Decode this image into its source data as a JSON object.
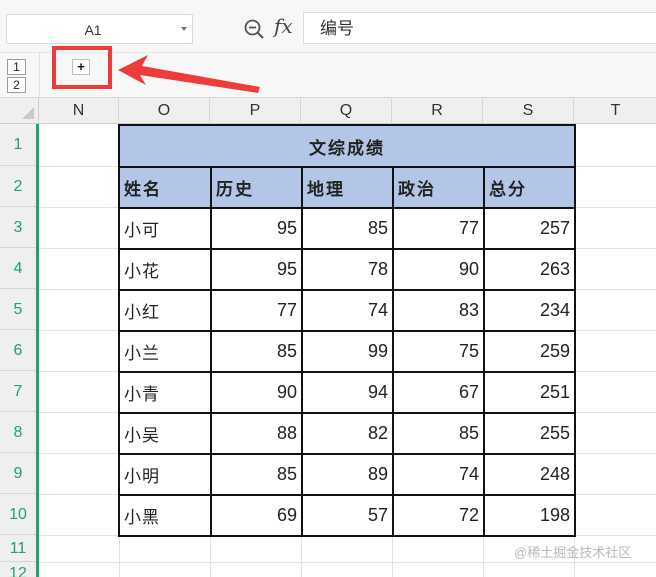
{
  "formula_bar": {
    "cell_ref": "A1",
    "fx_label": "fx",
    "content": "编号"
  },
  "outline": {
    "levels": [
      "1",
      "2"
    ],
    "expand_symbol": "+"
  },
  "columns": [
    "N",
    "O",
    "P",
    "Q",
    "R",
    "S",
    "T"
  ],
  "rows": [
    "1",
    "2",
    "3",
    "4",
    "5",
    "6",
    "7",
    "8",
    "9",
    "10",
    "11",
    "12"
  ],
  "table": {
    "title": "文综成绩",
    "headers": [
      "姓名",
      "历史",
      "地理",
      "政治",
      "总分"
    ],
    "records": [
      {
        "name": "小可",
        "history": "95",
        "geography": "85",
        "politics": "77",
        "total": "257"
      },
      {
        "name": "小花",
        "history": "95",
        "geography": "78",
        "politics": "90",
        "total": "263"
      },
      {
        "name": "小红",
        "history": "77",
        "geography": "74",
        "politics": "83",
        "total": "234"
      },
      {
        "name": "小兰",
        "history": "85",
        "geography": "99",
        "politics": "75",
        "total": "259"
      },
      {
        "name": "小青",
        "history": "90",
        "geography": "94",
        "politics": "67",
        "total": "251"
      },
      {
        "name": "小吴",
        "history": "88",
        "geography": "82",
        "politics": "85",
        "total": "255"
      },
      {
        "name": "小明",
        "history": "85",
        "geography": "89",
        "politics": "74",
        "total": "248"
      },
      {
        "name": "小黑",
        "history": "69",
        "geography": "57",
        "politics": "72",
        "total": "198"
      }
    ]
  },
  "colors": {
    "header_fill": "#b4c6e7",
    "row_header_accent": "#21a366",
    "annotation_red": "#ee3b3b"
  },
  "icons": [
    "zoom-icon",
    "dropdown-caret-icon",
    "expand-plus-icon",
    "annotation-arrow-icon"
  ],
  "watermark": "@稀土掘金技术社区"
}
